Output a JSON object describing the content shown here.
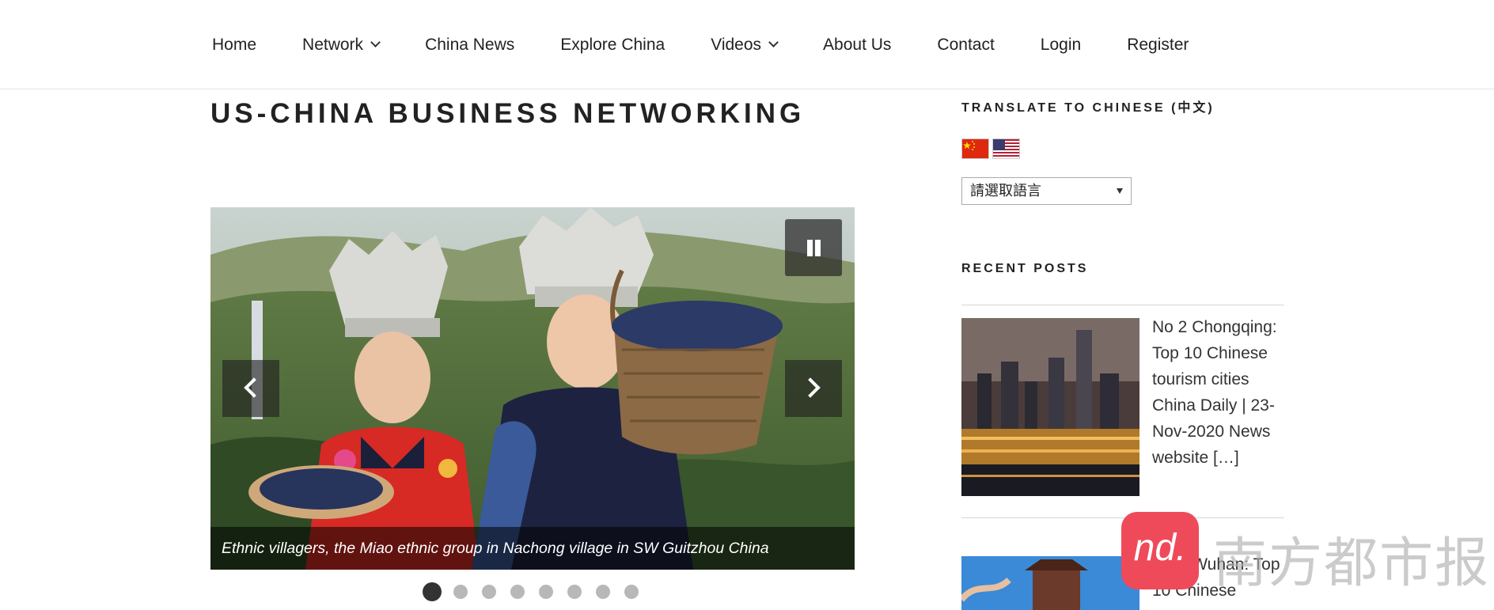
{
  "nav": {
    "items": [
      {
        "label": "Home",
        "has_dropdown": false
      },
      {
        "label": "Network",
        "has_dropdown": true
      },
      {
        "label": "China News",
        "has_dropdown": false
      },
      {
        "label": "Explore China",
        "has_dropdown": false
      },
      {
        "label": "Videos",
        "has_dropdown": true
      },
      {
        "label": "About Us",
        "has_dropdown": false
      },
      {
        "label": "Contact",
        "has_dropdown": false
      },
      {
        "label": "Login",
        "has_dropdown": false
      },
      {
        "label": "Register",
        "has_dropdown": false
      }
    ]
  },
  "page": {
    "title": "US-CHINA BUSINESS NETWORKING"
  },
  "slider": {
    "caption": "Ethnic villagers, the Miao ethnic group in Nachong village in SW Guitzhou China",
    "slide_count": 8,
    "active_slide": 1,
    "icons": {
      "pause": "pause-icon",
      "prev": "chevron-left-icon",
      "next": "chevron-right-icon"
    }
  },
  "sidebar": {
    "translate": {
      "title": "TRANSLATE TO CHINESE (中文)",
      "flags": [
        "china-flag-icon",
        "usa-flag-icon"
      ],
      "select_value": "請選取語言"
    },
    "recent_posts": {
      "title": "RECENT POSTS",
      "posts": [
        {
          "text": "No 2 Chongqing: Top 10 Chinese tourism cities China Daily | 23-Nov-2020 News website […]"
        },
        {
          "text": "No 8 Wuhan: Top 10 Chinese"
        }
      ]
    }
  },
  "watermark": {
    "logo_text": "nd.",
    "text": "南方都市报"
  },
  "colors": {
    "accent_red": "#ef4a5a",
    "nav_text": "#222222"
  }
}
